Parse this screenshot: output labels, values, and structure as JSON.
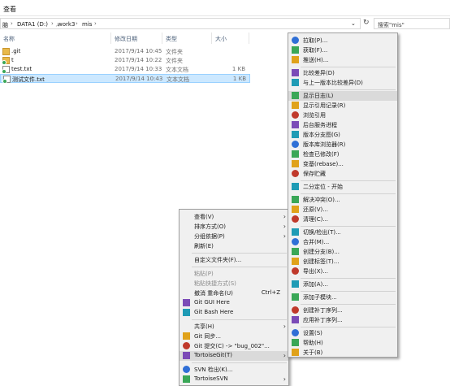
{
  "ribbon": {
    "label": "查看"
  },
  "address": {
    "parts": [
      "脑",
      "DATA1 (D:)",
      "work3",
      "mis"
    ],
    "refresh_icon": "refresh-icon"
  },
  "search": {
    "placeholder": "搜索\"mis\""
  },
  "columns": [
    "名称",
    "修改日期",
    "类型",
    "大小"
  ],
  "files": [
    {
      "name": ".git",
      "date": "2017/9/14 10:45",
      "type": "文件夹",
      "size": "",
      "icon": "folder"
    },
    {
      "name": "t",
      "date": "2017/9/14 10:22",
      "type": "文件夹",
      "size": "",
      "icon": "folder-git"
    },
    {
      "name": "test.txt",
      "date": "2017/9/14 10:33",
      "type": "文本文档",
      "size": "1 KB",
      "icon": "txt-git"
    },
    {
      "name": "测试文件.txt",
      "date": "2017/9/14 10:43",
      "type": "文本文档",
      "size": "1 KB",
      "icon": "txt-git",
      "selected": true
    }
  ],
  "context_menu": {
    "items": [
      {
        "label": "查看(V)",
        "arrow": true
      },
      {
        "label": "排序方式(O)",
        "arrow": true
      },
      {
        "label": "分组依据(P)",
        "arrow": true
      },
      {
        "label": "刷新(E)"
      },
      {
        "sep": true
      },
      {
        "label": "自定义文件夹(F)..."
      },
      {
        "sep": true
      },
      {
        "label": "粘贴(P)",
        "disabled": true
      },
      {
        "label": "粘贴快捷方式(S)",
        "disabled": true
      },
      {
        "label": "撤消 重命名(U)",
        "shortcut": "Ctrl+Z"
      },
      {
        "label": "Git GUI Here",
        "icon": "git-gui-icon"
      },
      {
        "label": "Git Bash Here",
        "icon": "git-bash-icon"
      },
      {
        "sep": true
      },
      {
        "label": "共享(H)",
        "arrow": true
      },
      {
        "label": "Git 同步...",
        "icon": "git-sync-icon"
      },
      {
        "label": "Git 提交(C) -> \"bug_002\"...",
        "icon": "git-commit-icon"
      },
      {
        "label": "TortoiseGit(T)",
        "icon": "tortoisegit-icon",
        "arrow": true,
        "highlight": true
      },
      {
        "sep": true
      },
      {
        "label": "SVN 检出(K)...",
        "icon": "svn-checkout-icon"
      },
      {
        "label": "TortoiseSVN",
        "icon": "tortoisesvn-icon",
        "arrow": true
      }
    ]
  },
  "submenu": {
    "items": [
      {
        "label": "拉取(P)...",
        "icon": "pull-icon"
      },
      {
        "label": "获取(F)...",
        "icon": "fetch-icon"
      },
      {
        "label": "推送(H)...",
        "icon": "push-icon"
      },
      {
        "sep": true
      },
      {
        "label": "比较差异(D)",
        "icon": "diff-icon"
      },
      {
        "label": "与上一版本比较差异(D)",
        "icon": "diff-prev-icon"
      },
      {
        "sep": true
      },
      {
        "label": "显示日志(L)",
        "icon": "log-icon",
        "highlight": true
      },
      {
        "label": "显示引用记录(R)",
        "icon": "reflog-icon"
      },
      {
        "label": "浏览引用",
        "icon": "browse-refs-icon"
      },
      {
        "label": "后台服务进程",
        "icon": "daemon-icon"
      },
      {
        "label": "版本分支图(G)",
        "icon": "revision-graph-icon"
      },
      {
        "label": "版本库浏览器(R)",
        "icon": "repo-browser-icon"
      },
      {
        "label": "检查已修改(F)",
        "icon": "check-modifications-icon"
      },
      {
        "label": "变基(rebase)...",
        "icon": "rebase-icon"
      },
      {
        "label": "保存贮藏",
        "icon": "stash-icon"
      },
      {
        "sep": true
      },
      {
        "label": "二分定位 - 开始",
        "icon": "bisect-icon"
      },
      {
        "sep": true
      },
      {
        "label": "解决冲突(O)...",
        "icon": "resolve-icon"
      },
      {
        "label": "还原(V)...",
        "icon": "revert-icon"
      },
      {
        "label": "清理(C)...",
        "icon": "cleanup-icon"
      },
      {
        "sep": true
      },
      {
        "label": "切换/检出(T)...",
        "icon": "switch-icon"
      },
      {
        "label": "合并(M)...",
        "icon": "merge-icon"
      },
      {
        "label": "创建分支(B)...",
        "icon": "branch-icon"
      },
      {
        "label": "创建标签(T)...",
        "icon": "tag-icon"
      },
      {
        "label": "导出(X)...",
        "icon": "export-icon"
      },
      {
        "sep": true
      },
      {
        "label": "添加(A)...",
        "icon": "add-icon"
      },
      {
        "sep": true
      },
      {
        "label": "添加子模块...",
        "icon": "submodule-icon"
      },
      {
        "sep": true
      },
      {
        "label": "创建补丁序列...",
        "icon": "create-patch-icon"
      },
      {
        "label": "应用补丁序列...",
        "icon": "apply-patch-icon"
      },
      {
        "sep": true
      },
      {
        "label": "设置(S)",
        "icon": "settings-icon"
      },
      {
        "label": "帮助(H)",
        "icon": "help-icon"
      },
      {
        "label": "关于(B)",
        "icon": "about-icon"
      }
    ]
  }
}
